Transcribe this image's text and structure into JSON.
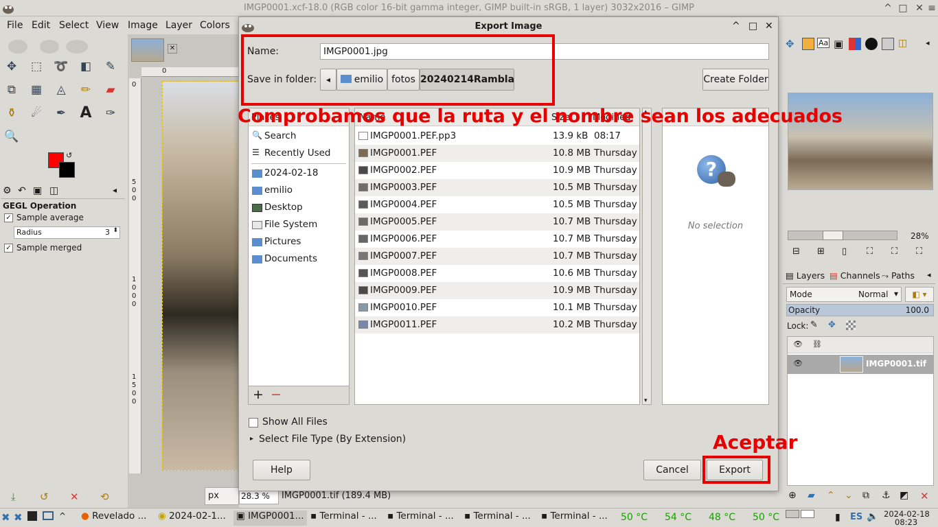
{
  "window": {
    "title": "IMGP0001.xcf-18.0 (RGB color 16-bit gamma integer, GIMP built-in sRGB, 1 layer) 3032x2016 – GIMP"
  },
  "menu": [
    "File",
    "Edit",
    "Select",
    "View",
    "Image",
    "Layer",
    "Colors"
  ],
  "toolbox": {
    "section_title": "GEGL Operation",
    "sample_average": "Sample average",
    "radius_label": "Radius",
    "radius_value": "3",
    "sample_merged": "Sample merged"
  },
  "canvas": {
    "ruler_top_0": "0",
    "ruler_left": [
      "0",
      "5\n0\n0",
      "1\n0\n0\n0",
      "1\n5\n0\n0"
    ],
    "unit": "px",
    "zoom": "28.3 %",
    "status": "IMGP0001.tif (189.4 MB)"
  },
  "dialog": {
    "title": "Export Image",
    "name_label": "Name:",
    "name_value": "IMGP0001.jpg",
    "folder_label": "Save in folder:",
    "breadcrumb": [
      "emilio",
      "fotos",
      "20240214Rambla"
    ],
    "create_folder": "Create Folder",
    "places_header": "Places",
    "places": [
      {
        "label": "Search",
        "icon": "search-icon"
      },
      {
        "label": "Recently Used",
        "icon": "recent-icon"
      },
      {
        "label": "2024-02-18",
        "icon": "folder-icon"
      },
      {
        "label": "emilio",
        "icon": "home-folder-icon"
      },
      {
        "label": "Desktop",
        "icon": "desktop-icon"
      },
      {
        "label": "File System",
        "icon": "drive-icon"
      },
      {
        "label": "Pictures",
        "icon": "folder-icon"
      },
      {
        "label": "Documents",
        "icon": "folder-icon"
      }
    ],
    "columns": {
      "name": "Name",
      "size": "Size",
      "modified": "Modified"
    },
    "files": [
      {
        "name": "IMGP0001.PEF.pp3",
        "size": "13.9 kB",
        "modified": "08:17"
      },
      {
        "name": "IMGP0001.PEF",
        "size": "10.8 MB",
        "modified": "Thursday"
      },
      {
        "name": "IMGP0002.PEF",
        "size": "10.9 MB",
        "modified": "Thursday"
      },
      {
        "name": "IMGP0003.PEF",
        "size": "10.5 MB",
        "modified": "Thursday"
      },
      {
        "name": "IMGP0004.PEF",
        "size": "10.5 MB",
        "modified": "Thursday"
      },
      {
        "name": "IMGP0005.PEF",
        "size": "10.7 MB",
        "modified": "Thursday"
      },
      {
        "name": "IMGP0006.PEF",
        "size": "10.7 MB",
        "modified": "Thursday"
      },
      {
        "name": "IMGP0007.PEF",
        "size": "10.7 MB",
        "modified": "Thursday"
      },
      {
        "name": "IMGP0008.PEF",
        "size": "10.6 MB",
        "modified": "Thursday"
      },
      {
        "name": "IMGP0009.PEF",
        "size": "10.9 MB",
        "modified": "Thursday"
      },
      {
        "name": "IMGP0010.PEF",
        "size": "10.1 MB",
        "modified": "Thursday"
      },
      {
        "name": "IMGP0011.PEF",
        "size": "10.2 MB",
        "modified": "Thursday"
      }
    ],
    "preview_text": "No selection",
    "show_all_files": "Show All Files",
    "select_file_type": "Select File Type (By Extension)",
    "help": "Help",
    "cancel": "Cancel",
    "export": "Export"
  },
  "annotations": {
    "route_note": "Comprobamos que la ruta y el nombre sean los adecuados",
    "accept_note": "Aceptar",
    "color": "#e60000"
  },
  "dock": {
    "zoom": "28%",
    "tabs": [
      "Layers",
      "Channels",
      "Paths"
    ],
    "mode_label": "Mode",
    "mode_value": "Normal",
    "opacity_label": "Opacity",
    "opacity_value": "100.0",
    "lock_label": "Lock:",
    "layer_name": "IMGP0001.tif"
  },
  "taskbar": {
    "tasks": [
      "Revelado ...",
      "2024-02-1...",
      "IMGP0001...",
      "Terminal - ...",
      "Terminal - ...",
      "Terminal - ...",
      "Terminal - ..."
    ],
    "temps": [
      "50 °C",
      "54 °C",
      "48 °C",
      "50 °C"
    ],
    "lang": "ES",
    "date": "2024-02-18",
    "time": "08:23"
  }
}
